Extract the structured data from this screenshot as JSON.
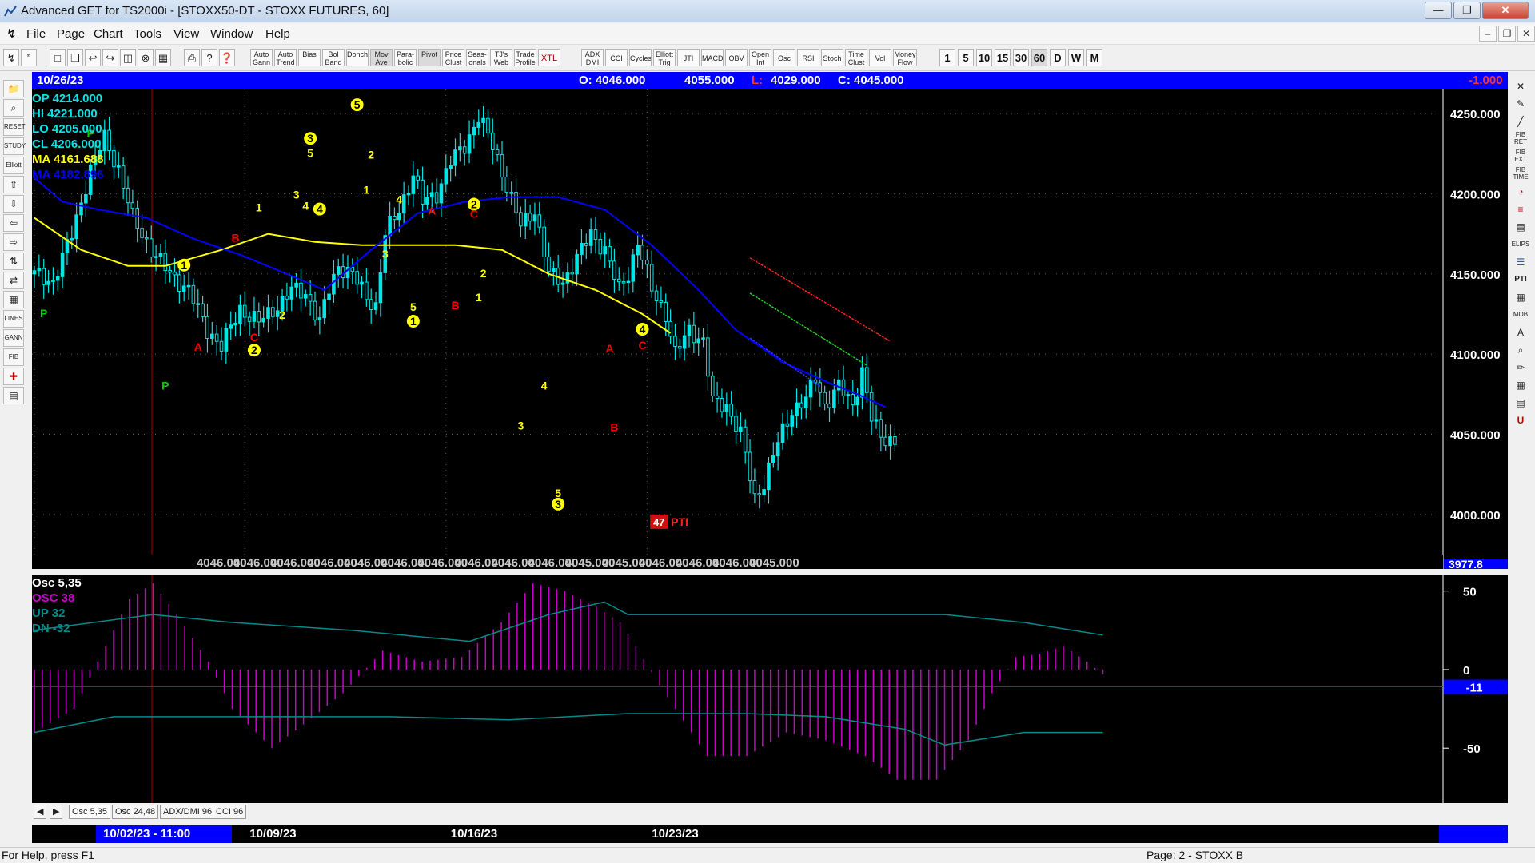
{
  "window": {
    "title": "Advanced GET for TS2000i - [STOXX50-DT - STOXX FUTURES, 60]"
  },
  "menu": [
    "File",
    "Page",
    "Chart",
    "Tools",
    "View",
    "Window",
    "Help"
  ],
  "toolbar": {
    "study_buttons": [
      "Auto Gann",
      "Auto Trend",
      "Bias",
      "Bol Band",
      "Donch",
      "Mov Ave",
      "Para- bolic",
      "Pivot",
      "Price Clust",
      "Seas- onals",
      "TJ's Web",
      "Trade Profile",
      "XTL",
      "ADX DMI",
      "CCI",
      "Cycles",
      "Elliott Trig",
      "JTI",
      "MACD",
      "OBV",
      "Open Int",
      "Osc",
      "RSI",
      "Stoch",
      "Time Clust",
      "Vol",
      "Money Flow"
    ],
    "timeframes": [
      "1",
      "5",
      "10",
      "15",
      "30",
      "60",
      "D",
      "W",
      "M"
    ]
  },
  "header": {
    "date": "10/26/23",
    "open": "O: 4046.000",
    "high": "4055.000",
    "low_label": "L:",
    "low": "4029.000",
    "close": "C: 4045.000",
    "change": "-1.000"
  },
  "legend": {
    "op": "OP  4214.000",
    "hi": "HI   4221.000",
    "lo": "LO  4205.000",
    "cl": "CL  4206.000",
    "ma1": "MA  4161.688",
    "ma2": "MA  4182.896"
  },
  "colors": {
    "candle": "#00e5e5",
    "ma_yellow": "#ffff00",
    "ma_blue": "#0000ff",
    "osc": "#cc00cc",
    "band": "#008b8b",
    "wave_label": "#ffff00",
    "abc_label": "#ff0000",
    "pivot_label": "#00cc00",
    "header_bg": "#0000ff"
  },
  "chart_data": [
    {
      "type": "candlestick",
      "title": "STOXX50-DT - STOXX FUTURES, 60",
      "ylim": [
        3975,
        4265
      ],
      "y_ticks": [
        "4250.000",
        "4200.000",
        "4150.000",
        "4100.000",
        "4050.000",
        "4000.000"
      ],
      "y_tick_values": [
        4250,
        4200,
        4150,
        4100,
        4050,
        4000
      ],
      "last_price_label": "3977.8",
      "x_labels": [
        "10/02/23 - 11:00",
        "10/09/23",
        "10/16/23",
        "10/23/23"
      ],
      "x_label_index": [
        0,
        45,
        88,
        131
      ],
      "bar_count": 170,
      "bottom_values": [
        "4046.000",
        "4046.000",
        "4046.000",
        "4046.000",
        "4046.000",
        "4046.000",
        "4046.000",
        "4046.000",
        "4046.000",
        "4046.000",
        "4045.000",
        "4045.000",
        "4046.000",
        "4046.000",
        "4046.000",
        "4045.000"
      ],
      "bottom_value_index": [
        61,
        73,
        85,
        97,
        109,
        121,
        133,
        145,
        157,
        169,
        181,
        193,
        205,
        217,
        229,
        241
      ],
      "anchors": [
        {
          "i": 0,
          "p": 4150
        },
        {
          "i": 4,
          "p": 4145
        },
        {
          "i": 8,
          "p": 4175
        },
        {
          "i": 12,
          "p": 4215
        },
        {
          "i": 15,
          "p": 4235
        },
        {
          "i": 18,
          "p": 4215
        },
        {
          "i": 21,
          "p": 4185
        },
        {
          "i": 25,
          "p": 4165
        },
        {
          "i": 29,
          "p": 4150
        },
        {
          "i": 33,
          "p": 4140
        },
        {
          "i": 37,
          "p": 4115
        },
        {
          "i": 40,
          "p": 4105
        },
        {
          "i": 44,
          "p": 4128
        },
        {
          "i": 48,
          "p": 4120
        },
        {
          "i": 52,
          "p": 4130
        },
        {
          "i": 55,
          "p": 4140
        },
        {
          "i": 58,
          "p": 4138
        },
        {
          "i": 61,
          "p": 4120
        },
        {
          "i": 63,
          "p": 4140
        },
        {
          "i": 65,
          "p": 4155
        },
        {
          "i": 68,
          "p": 4150
        },
        {
          "i": 71,
          "p": 4135
        },
        {
          "i": 73,
          "p": 4130
        },
        {
          "i": 75,
          "p": 4175
        },
        {
          "i": 78,
          "p": 4190
        },
        {
          "i": 81,
          "p": 4212
        },
        {
          "i": 83,
          "p": 4195
        },
        {
          "i": 86,
          "p": 4200
        },
        {
          "i": 89,
          "p": 4220
        },
        {
          "i": 92,
          "p": 4230
        },
        {
          "i": 95,
          "p": 4248
        },
        {
          "i": 98,
          "p": 4230
        },
        {
          "i": 101,
          "p": 4205
        },
        {
          "i": 104,
          "p": 4180
        },
        {
          "i": 107,
          "p": 4190
        },
        {
          "i": 110,
          "p": 4150
        },
        {
          "i": 113,
          "p": 4145
        },
        {
          "i": 116,
          "p": 4160
        },
        {
          "i": 119,
          "p": 4175
        },
        {
          "i": 122,
          "p": 4165
        },
        {
          "i": 125,
          "p": 4140
        },
        {
          "i": 127,
          "p": 4150
        },
        {
          "i": 129,
          "p": 4170
        },
        {
          "i": 132,
          "p": 4140
        },
        {
          "i": 135,
          "p": 4125
        },
        {
          "i": 137,
          "p": 4100
        },
        {
          "i": 140,
          "p": 4115
        },
        {
          "i": 143,
          "p": 4108
        },
        {
          "i": 145,
          "p": 4070
        },
        {
          "i": 148,
          "p": 4068
        },
        {
          "i": 151,
          "p": 4050
        },
        {
          "i": 154,
          "p": 4010
        },
        {
          "i": 156,
          "p": 4020
        },
        {
          "i": 159,
          "p": 4045
        },
        {
          "i": 162,
          "p": 4065
        },
        {
          "i": 165,
          "p": 4072
        },
        {
          "i": 167,
          "p": 4085
        },
        {
          "i": 169,
          "p": 4068
        },
        {
          "i": 172,
          "p": 4080
        },
        {
          "i": 175,
          "p": 4068
        },
        {
          "i": 177,
          "p": 4090
        },
        {
          "i": 179,
          "p": 4060
        },
        {
          "i": 181,
          "p": 4048
        },
        {
          "i": 184,
          "p": 4046
        }
      ],
      "ma_yellow": [
        {
          "i": 0,
          "p": 4185
        },
        {
          "i": 10,
          "p": 4165
        },
        {
          "i": 20,
          "p": 4155
        },
        {
          "i": 28,
          "p": 4155
        },
        {
          "i": 40,
          "p": 4165
        },
        {
          "i": 50,
          "p": 4175
        },
        {
          "i": 60,
          "p": 4170
        },
        {
          "i": 70,
          "p": 4168
        },
        {
          "i": 80,
          "p": 4168
        },
        {
          "i": 90,
          "p": 4168
        },
        {
          "i": 100,
          "p": 4165
        },
        {
          "i": 110,
          "p": 4150
        },
        {
          "i": 120,
          "p": 4140
        },
        {
          "i": 130,
          "p": 4125
        },
        {
          "i": 136,
          "p": 4113
        }
      ],
      "ma_blue": [
        {
          "i": 0,
          "p": 4210
        },
        {
          "i": 6,
          "p": 4195
        },
        {
          "i": 14,
          "p": 4190
        },
        {
          "i": 24,
          "p": 4185
        },
        {
          "i": 34,
          "p": 4172
        },
        {
          "i": 44,
          "p": 4162
        },
        {
          "i": 54,
          "p": 4150
        },
        {
          "i": 62,
          "p": 4140
        },
        {
          "i": 72,
          "p": 4165
        },
        {
          "i": 82,
          "p": 4188
        },
        {
          "i": 92,
          "p": 4195
        },
        {
          "i": 102,
          "p": 4198
        },
        {
          "i": 112,
          "p": 4198
        },
        {
          "i": 122,
          "p": 4190
        },
        {
          "i": 132,
          "p": 4168
        },
        {
          "i": 142,
          "p": 4140
        },
        {
          "i": 150,
          "p": 4115
        },
        {
          "i": 160,
          "p": 4095
        },
        {
          "i": 170,
          "p": 4082
        },
        {
          "i": 176,
          "p": 4075
        },
        {
          "i": 182,
          "p": 4067
        }
      ],
      "channel_red": {
        "i1": 153,
        "p1": 4160,
        "i2": 183,
        "p2": 4108
      },
      "channel_green": {
        "i1": 153,
        "p1": 4138,
        "i2": 178,
        "p2": 4093
      },
      "channel_blue": {
        "i1": 153,
        "p1": 4110,
        "i2": 168,
        "p2": 4080
      },
      "labels": [
        {
          "t": "P",
          "i": 12,
          "p": 4235,
          "c": "pivot",
          "circle": false
        },
        {
          "t": "P",
          "i": 2,
          "p": 4123,
          "c": "pivot",
          "circle": false
        },
        {
          "t": "P",
          "i": 28,
          "p": 4078,
          "c": "pivot",
          "circle": false
        },
        {
          "t": "1",
          "i": 32,
          "p": 4153,
          "c": "wave",
          "circle": true
        },
        {
          "t": "A",
          "i": 35,
          "p": 4102,
          "c": "abc",
          "circle": false
        },
        {
          "t": "B",
          "i": 43,
          "p": 4170,
          "c": "abc",
          "circle": false
        },
        {
          "t": "C",
          "i": 47,
          "p": 4108,
          "c": "abc",
          "circle": false
        },
        {
          "t": "2",
          "i": 47,
          "p": 4100,
          "c": "wave",
          "circle": true
        },
        {
          "t": "1",
          "i": 48,
          "p": 4189,
          "c": "wave",
          "circle": false
        },
        {
          "t": "2",
          "i": 53,
          "p": 4122,
          "c": "wave",
          "circle": false
        },
        {
          "t": "3",
          "i": 56,
          "p": 4197,
          "c": "wave",
          "circle": false
        },
        {
          "t": "3",
          "i": 59,
          "p": 4232,
          "c": "wave",
          "circle": true
        },
        {
          "t": "5",
          "i": 59,
          "p": 4223,
          "c": "wave",
          "circle": false
        },
        {
          "t": "4",
          "i": 58,
          "p": 4190,
          "c": "wave",
          "circle": false
        },
        {
          "t": "4",
          "i": 61,
          "p": 4188,
          "c": "wave",
          "circle": true
        },
        {
          "t": "5",
          "i": 69,
          "p": 4253,
          "c": "wave",
          "circle": true
        },
        {
          "t": "2",
          "i": 72,
          "p": 4222,
          "c": "wave",
          "circle": false
        },
        {
          "t": "1",
          "i": 71,
          "p": 4200,
          "c": "wave",
          "circle": false
        },
        {
          "t": "4",
          "i": 78,
          "p": 4194,
          "c": "wave",
          "circle": false
        },
        {
          "t": "3",
          "i": 75,
          "p": 4160,
          "c": "wave",
          "circle": false
        },
        {
          "t": "5",
          "i": 81,
          "p": 4127,
          "c": "wave",
          "circle": false
        },
        {
          "t": "1",
          "i": 81,
          "p": 4118,
          "c": "wave",
          "circle": true
        },
        {
          "t": "A",
          "i": 85,
          "p": 4187,
          "c": "abc",
          "circle": false
        },
        {
          "t": "2",
          "i": 94,
          "p": 4191,
          "c": "wave",
          "circle": true
        },
        {
          "t": "C",
          "i": 94,
          "p": 4185,
          "c": "abc",
          "circle": false
        },
        {
          "t": "2",
          "i": 96,
          "p": 4148,
          "c": "wave",
          "circle": false
        },
        {
          "t": "B",
          "i": 90,
          "p": 4128,
          "c": "abc",
          "circle": false
        },
        {
          "t": "1",
          "i": 95,
          "p": 4133,
          "c": "wave",
          "circle": false
        },
        {
          "t": "4",
          "i": 109,
          "p": 4078,
          "c": "wave",
          "circle": false
        },
        {
          "t": "3",
          "i": 104,
          "p": 4053,
          "c": "wave",
          "circle": false
        },
        {
          "t": "5",
          "i": 112,
          "p": 4011,
          "c": "wave",
          "circle": false
        },
        {
          "t": "3",
          "i": 112,
          "p": 4004,
          "c": "wave",
          "circle": true
        },
        {
          "t": "A",
          "i": 123,
          "p": 4101,
          "c": "abc",
          "circle": false
        },
        {
          "t": "B",
          "i": 124,
          "p": 4052,
          "c": "abc",
          "circle": false
        },
        {
          "t": "4",
          "i": 130,
          "p": 4113,
          "c": "wave",
          "circle": true
        },
        {
          "t": "C",
          "i": 130,
          "p": 4103,
          "c": "abc",
          "circle": false
        }
      ],
      "pti_value": "47",
      "pti_label": "PTI"
    },
    {
      "type": "bar",
      "title": "Osc 5,35",
      "legend": [
        "OSC 38",
        "UP  32",
        "DN  -32"
      ],
      "ylim": [
        -85,
        60
      ],
      "y_ticks": [
        "50",
        "0",
        "-50"
      ],
      "y_tick_values": [
        50,
        0,
        -50
      ],
      "current_label": "-11",
      "current_value": -11,
      "osc_anchors": [
        {
          "i": 0,
          "v": -40
        },
        {
          "i": 5,
          "v": -25
        },
        {
          "i": 8,
          "v": 5
        },
        {
          "i": 12,
          "v": 45
        },
        {
          "i": 15,
          "v": 55
        },
        {
          "i": 18,
          "v": 35
        },
        {
          "i": 22,
          "v": 5
        },
        {
          "i": 25,
          "v": -25
        },
        {
          "i": 30,
          "v": -50
        },
        {
          "i": 34,
          "v": -35
        },
        {
          "i": 39,
          "v": -15
        },
        {
          "i": 44,
          "v": 12
        },
        {
          "i": 49,
          "v": 5
        },
        {
          "i": 54,
          "v": 8
        },
        {
          "i": 59,
          "v": 30
        },
        {
          "i": 63,
          "v": 55
        },
        {
          "i": 67,
          "v": 50
        },
        {
          "i": 71,
          "v": 40
        },
        {
          "i": 74,
          "v": 30
        },
        {
          "i": 76,
          "v": 15
        },
        {
          "i": 79,
          "v": -10
        },
        {
          "i": 85,
          "v": -55
        },
        {
          "i": 90,
          "v": -55
        },
        {
          "i": 95,
          "v": -40
        },
        {
          "i": 100,
          "v": -45
        },
        {
          "i": 105,
          "v": -55
        },
        {
          "i": 109,
          "v": -70
        },
        {
          "i": 114,
          "v": -70
        },
        {
          "i": 118,
          "v": -45
        },
        {
          "i": 121,
          "v": -15
        },
        {
          "i": 124,
          "v": 8
        },
        {
          "i": 127,
          "v": 10
        },
        {
          "i": 130,
          "v": 15
        },
        {
          "i": 133,
          "v": 5
        },
        {
          "i": 135,
          "v": -3
        }
      ],
      "up_band": [
        {
          "i": 0,
          "v": 25
        },
        {
          "i": 15,
          "v": 35
        },
        {
          "i": 25,
          "v": 30
        },
        {
          "i": 40,
          "v": 25
        },
        {
          "i": 55,
          "v": 18
        },
        {
          "i": 65,
          "v": 35
        },
        {
          "i": 72,
          "v": 43
        },
        {
          "i": 75,
          "v": 35
        },
        {
          "i": 90,
          "v": 35
        },
        {
          "i": 115,
          "v": 35
        },
        {
          "i": 125,
          "v": 30
        },
        {
          "i": 135,
          "v": 22
        }
      ],
      "dn_band": [
        {
          "i": 0,
          "v": -40
        },
        {
          "i": 10,
          "v": -30
        },
        {
          "i": 30,
          "v": -30
        },
        {
          "i": 45,
          "v": -30
        },
        {
          "i": 60,
          "v": -32
        },
        {
          "i": 75,
          "v": -28
        },
        {
          "i": 90,
          "v": -28
        },
        {
          "i": 100,
          "v": -30
        },
        {
          "i": 110,
          "v": -38
        },
        {
          "i": 115,
          "v": -48
        },
        {
          "i": 125,
          "v": -40
        },
        {
          "i": 135,
          "v": -40
        }
      ]
    }
  ],
  "osc_tabs": [
    "Osc 5,35",
    "Osc 24,48",
    "ADX/DMI 96",
    "CCI 96"
  ],
  "status": {
    "help": "For Help, press F1",
    "page": "Page: 2 - STOXX B"
  }
}
